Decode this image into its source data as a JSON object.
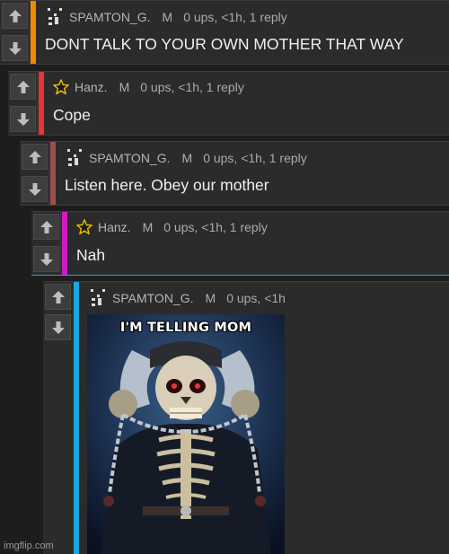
{
  "colors": {
    "background": "#1d1d1d",
    "comment_bg": "#2b2b2b",
    "depth_bars": [
      "#f08a00",
      "#e8343a",
      "#9a4f4f",
      "#d219c8",
      "#1aa8e0"
    ]
  },
  "comments": [
    {
      "username": "SPAMTON_G.",
      "badge": "M",
      "stats": "0 ups, <1h, 1 reply",
      "text": "DONT TALK TO YOUR OWN MOTHER THAT WAY",
      "avatar": "pixel-avatar-icon"
    },
    {
      "username": "Hanz.",
      "badge": "M",
      "stats": "0 ups, <1h, 1 reply",
      "text": "Cope",
      "avatar": "star-icon"
    },
    {
      "username": "SPAMTON_G.",
      "badge": "M",
      "stats": "0 ups, <1h, 1 reply",
      "text": "Listen here. Obey our mother",
      "avatar": "pixel-avatar-icon"
    },
    {
      "username": "Hanz.",
      "badge": "M",
      "stats": "0 ups, <1h, 1 reply",
      "text": "Nah",
      "avatar": "star-icon"
    },
    {
      "username": "SPAMTON_G.",
      "badge": "M",
      "stats": "0 ups, <1h",
      "avatar": "pixel-avatar-icon",
      "image_caption": "I'M TELLING MOM"
    }
  ],
  "icons": {
    "upvote": "upvote-arrow-icon",
    "downvote": "downvote-arrow-icon"
  },
  "watermark": "imgflip.com"
}
